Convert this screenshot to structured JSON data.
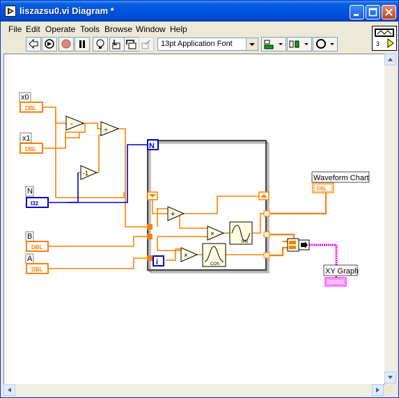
{
  "window": {
    "title": "liszazsu0.vi Diagram *"
  },
  "menubar": {
    "items": [
      "File",
      "Edit",
      "Operate",
      "Tools",
      "Browse",
      "Window",
      "Help"
    ]
  },
  "toolbar": {
    "font_selector": "13pt Application Font"
  },
  "context_help": {
    "value": "3"
  },
  "diagram": {
    "controls": {
      "x0": {
        "label": "x0",
        "type": "DBL"
      },
      "x1": {
        "label": "x1",
        "type": "DBL"
      },
      "n": {
        "label": "N",
        "type": "I32"
      },
      "b": {
        "label": "B",
        "type": "DBL"
      },
      "a": {
        "label": "A",
        "type": "DBL"
      }
    },
    "indicators": {
      "chart": {
        "label": "Waveform Chart",
        "type": "DBL"
      },
      "graph": {
        "label": "XY Graph"
      }
    },
    "loop": {
      "count_terminal": "N",
      "iteration_terminal": "i"
    },
    "nodes": {
      "subtract1": "-",
      "divide": "÷",
      "subtract2": "-1",
      "add": "+",
      "multiply1": "×",
      "multiply2": "×",
      "sin": "SIN",
      "cos": "COS"
    }
  },
  "colors": {
    "title_bar": "#0054e3",
    "wire_dbl": "#ff8000",
    "wire_i32": "#0000c0",
    "wire_cluster": "#ff00ff"
  }
}
